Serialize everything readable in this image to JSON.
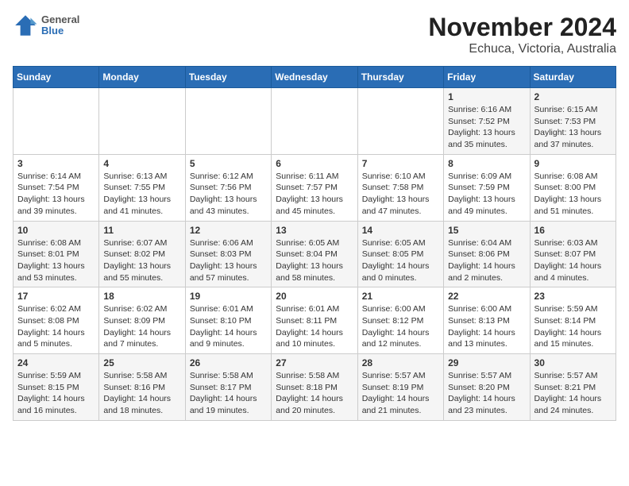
{
  "header": {
    "logo": {
      "general": "General",
      "blue": "Blue"
    },
    "title": "November 2024",
    "subtitle": "Echuca, Victoria, Australia"
  },
  "weekdays": [
    "Sunday",
    "Monday",
    "Tuesday",
    "Wednesday",
    "Thursday",
    "Friday",
    "Saturday"
  ],
  "weeks": [
    [
      {
        "day": "",
        "info": ""
      },
      {
        "day": "",
        "info": ""
      },
      {
        "day": "",
        "info": ""
      },
      {
        "day": "",
        "info": ""
      },
      {
        "day": "",
        "info": ""
      },
      {
        "day": "1",
        "info": "Sunrise: 6:16 AM\nSunset: 7:52 PM\nDaylight: 13 hours\nand 35 minutes."
      },
      {
        "day": "2",
        "info": "Sunrise: 6:15 AM\nSunset: 7:53 PM\nDaylight: 13 hours\nand 37 minutes."
      }
    ],
    [
      {
        "day": "3",
        "info": "Sunrise: 6:14 AM\nSunset: 7:54 PM\nDaylight: 13 hours\nand 39 minutes."
      },
      {
        "day": "4",
        "info": "Sunrise: 6:13 AM\nSunset: 7:55 PM\nDaylight: 13 hours\nand 41 minutes."
      },
      {
        "day": "5",
        "info": "Sunrise: 6:12 AM\nSunset: 7:56 PM\nDaylight: 13 hours\nand 43 minutes."
      },
      {
        "day": "6",
        "info": "Sunrise: 6:11 AM\nSunset: 7:57 PM\nDaylight: 13 hours\nand 45 minutes."
      },
      {
        "day": "7",
        "info": "Sunrise: 6:10 AM\nSunset: 7:58 PM\nDaylight: 13 hours\nand 47 minutes."
      },
      {
        "day": "8",
        "info": "Sunrise: 6:09 AM\nSunset: 7:59 PM\nDaylight: 13 hours\nand 49 minutes."
      },
      {
        "day": "9",
        "info": "Sunrise: 6:08 AM\nSunset: 8:00 PM\nDaylight: 13 hours\nand 51 minutes."
      }
    ],
    [
      {
        "day": "10",
        "info": "Sunrise: 6:08 AM\nSunset: 8:01 PM\nDaylight: 13 hours\nand 53 minutes."
      },
      {
        "day": "11",
        "info": "Sunrise: 6:07 AM\nSunset: 8:02 PM\nDaylight: 13 hours\nand 55 minutes."
      },
      {
        "day": "12",
        "info": "Sunrise: 6:06 AM\nSunset: 8:03 PM\nDaylight: 13 hours\nand 57 minutes."
      },
      {
        "day": "13",
        "info": "Sunrise: 6:05 AM\nSunset: 8:04 PM\nDaylight: 13 hours\nand 58 minutes."
      },
      {
        "day": "14",
        "info": "Sunrise: 6:05 AM\nSunset: 8:05 PM\nDaylight: 14 hours\nand 0 minutes."
      },
      {
        "day": "15",
        "info": "Sunrise: 6:04 AM\nSunset: 8:06 PM\nDaylight: 14 hours\nand 2 minutes."
      },
      {
        "day": "16",
        "info": "Sunrise: 6:03 AM\nSunset: 8:07 PM\nDaylight: 14 hours\nand 4 minutes."
      }
    ],
    [
      {
        "day": "17",
        "info": "Sunrise: 6:02 AM\nSunset: 8:08 PM\nDaylight: 14 hours\nand 5 minutes."
      },
      {
        "day": "18",
        "info": "Sunrise: 6:02 AM\nSunset: 8:09 PM\nDaylight: 14 hours\nand 7 minutes."
      },
      {
        "day": "19",
        "info": "Sunrise: 6:01 AM\nSunset: 8:10 PM\nDaylight: 14 hours\nand 9 minutes."
      },
      {
        "day": "20",
        "info": "Sunrise: 6:01 AM\nSunset: 8:11 PM\nDaylight: 14 hours\nand 10 minutes."
      },
      {
        "day": "21",
        "info": "Sunrise: 6:00 AM\nSunset: 8:12 PM\nDaylight: 14 hours\nand 12 minutes."
      },
      {
        "day": "22",
        "info": "Sunrise: 6:00 AM\nSunset: 8:13 PM\nDaylight: 14 hours\nand 13 minutes."
      },
      {
        "day": "23",
        "info": "Sunrise: 5:59 AM\nSunset: 8:14 PM\nDaylight: 14 hours\nand 15 minutes."
      }
    ],
    [
      {
        "day": "24",
        "info": "Sunrise: 5:59 AM\nSunset: 8:15 PM\nDaylight: 14 hours\nand 16 minutes."
      },
      {
        "day": "25",
        "info": "Sunrise: 5:58 AM\nSunset: 8:16 PM\nDaylight: 14 hours\nand 18 minutes."
      },
      {
        "day": "26",
        "info": "Sunrise: 5:58 AM\nSunset: 8:17 PM\nDaylight: 14 hours\nand 19 minutes."
      },
      {
        "day": "27",
        "info": "Sunrise: 5:58 AM\nSunset: 8:18 PM\nDaylight: 14 hours\nand 20 minutes."
      },
      {
        "day": "28",
        "info": "Sunrise: 5:57 AM\nSunset: 8:19 PM\nDaylight: 14 hours\nand 21 minutes."
      },
      {
        "day": "29",
        "info": "Sunrise: 5:57 AM\nSunset: 8:20 PM\nDaylight: 14 hours\nand 23 minutes."
      },
      {
        "day": "30",
        "info": "Sunrise: 5:57 AM\nSunset: 8:21 PM\nDaylight: 14 hours\nand 24 minutes."
      }
    ]
  ]
}
